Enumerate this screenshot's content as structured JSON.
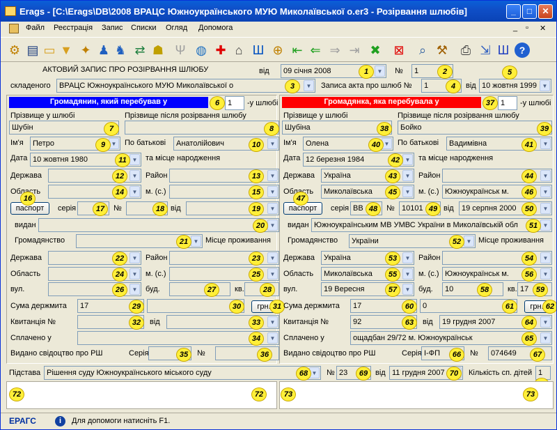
{
  "window": {
    "title": "Erags - [C:\\Erags\\DB\\2008 ВРАЦС Южноукраїнського МУЮ Миколаївської о.er3 - Розірвання шлюбів]",
    "min": "_",
    "max": "□",
    "close": "✕"
  },
  "menu": {
    "items": [
      "Файл",
      "Реєстрація",
      "Запис",
      "Списки",
      "Огляд",
      "Допомога"
    ],
    "min": "_",
    "restore": "▫",
    "close": "✕"
  },
  "header": {
    "title": "АКТОВИЙ ЗАПИС ПРО РОЗІРВАННЯ ШЛЮБУ",
    "vid": "від",
    "date": "09 січня 2008",
    "num_label": "№",
    "num": "1",
    "skl_label": "складеного",
    "skl": "ВРАЦС Южноукраїнського МУЮ Миколаївської о",
    "zap_label": "Записа акта про шлюб №",
    "zap": "1",
    "zap_vid": "від",
    "zap_date": "10 жовтня 1999"
  },
  "man": {
    "header": "Громадянин, який перебував у",
    "times": "1",
    "times_label": "-у шлюбі",
    "surname_label": "Прізвище у шлюбі",
    "surname": "Шубін",
    "surname_after_label": "Прізвище після розірвання шлюбу",
    "surname_after": "",
    "name_label": "Ім'я",
    "name": "Петро",
    "patr_label": "По батькові",
    "patr": "Анатолійович",
    "date_label": "Дата",
    "dob": "10 жовтня 1980",
    "birth_label": "та місце народження",
    "state_label": "Держава",
    "state": "",
    "district_label": "Район",
    "district": "",
    "region_label": "Область",
    "region": "",
    "city_label": "м. (с.)",
    "city": "",
    "passport": "паспорт",
    "series_label": "серія",
    "series": "",
    "no_label": "№",
    "pno": "",
    "pvid": "від",
    "pdate": "",
    "issued_label": "видан",
    "issued": "",
    "cit_label": "Громадянство",
    "cit": "",
    "res_label": "Місце проживання",
    "rstate": "",
    "rdistrict": "",
    "rregion": "",
    "rcity": "",
    "street_label": "вул.",
    "street": "",
    "bld_label": "буд.",
    "bld": "",
    "apt_label": "кв.",
    "apt": "",
    "fee_label": "Сума держмита",
    "fee": "17",
    "fee2": "",
    "grn": "грн.",
    "rec_label": "Квитанція №",
    "rec": "",
    "rec_vid": "від",
    "rec_date": "",
    "paid_label": "Сплачено у",
    "paid": "",
    "cert_label": "Видано свідоцтво про РШ",
    "cert_series_label": "Серія",
    "cert_series": "",
    "cert_no_label": "№",
    "cert_no": ""
  },
  "woman": {
    "header": "Громадянка, яка перебувала у",
    "times": "1",
    "times_label": "-у шлюбі",
    "surname_label": "Прізвище у шлюбі",
    "surname": "Шубіна",
    "surname_after_label": "Прізвище після розірвання шлюбу",
    "surname_after": "Бойко",
    "name_label": "Ім'я",
    "name": "Олена",
    "patr_label": "По батькові",
    "patr": "Вадимівна",
    "date_label": "Дата",
    "dob": "12 березня 1984",
    "birth_label": "та місце народження",
    "state_label": "Держава",
    "state": "Україна",
    "district_label": "Район",
    "district": "",
    "region_label": "Область",
    "region": "Миколаївська",
    "city_label": "м. (с.)",
    "city": "Южноукраїнськ м.",
    "passport": "паспорт",
    "series_label": "серія",
    "series": "ВВ",
    "no_label": "№",
    "pno": "10101",
    "pvid": "від",
    "pdate": "19 серпня 2000",
    "issued_label": "видан",
    "issued": "Южноукраїнським МВ УМВС України в Миколаївській обл",
    "cit_label": "Громадянство",
    "cit": "України",
    "res_label": "Місце проживання",
    "rstate": "Україна",
    "rdistrict": "",
    "rregion": "Миколаївська",
    "rcity": "Южноукраїнськ м.",
    "street_label": "вул.",
    "street": "19 Вересня",
    "bld_label": "буд.",
    "bld": "10",
    "apt_label": "кв.",
    "apt": "17",
    "fee_label": "Сума держмита",
    "fee": "17",
    "fee2": "0",
    "grn": "грн.",
    "rec_label": "Квитанція №",
    "rec": "92",
    "rec_vid": "від",
    "rec_date": "19 грудня 2007",
    "paid_label": "Сплачено у",
    "paid": "ощадбан 29/72 м. Южноукраїнськ",
    "cert_label": "Видано свідоцтво про РШ",
    "cert_series_label": "Серія",
    "cert_series": "І-ФП",
    "cert_no_label": "№",
    "cert_no": "074649"
  },
  "basis": {
    "label": "Підстава",
    "value": "Рішення суду Южноукраїнського міського суду",
    "no_label": "№",
    "no": "23",
    "vid": "від",
    "date": "11 грудня 2007",
    "kids_label": "Кількість сп. дітей",
    "kids": "1"
  },
  "status": {
    "app": "ЕРАГС",
    "help": "Для допомоги натисніть F1."
  },
  "markers": [
    "1",
    "2",
    "3",
    "4",
    "5",
    "6",
    "7",
    "8",
    "9",
    "10",
    "11",
    "12",
    "13",
    "14",
    "15",
    "16",
    "17",
    "18",
    "19",
    "20",
    "21",
    "22",
    "23",
    "24",
    "25",
    "26",
    "27",
    "28",
    "29",
    "30",
    "31",
    "32",
    "33",
    "34",
    "35",
    "36",
    "37",
    "38",
    "39",
    "40",
    "41",
    "42",
    "43",
    "44",
    "45",
    "46",
    "47",
    "48",
    "49",
    "50",
    "51",
    "52",
    "53",
    "54",
    "55",
    "56",
    "57",
    "58",
    "59",
    "60",
    "61",
    "62",
    "63",
    "64",
    "65",
    "66",
    "67",
    "68",
    "69",
    "70",
    "71",
    "72",
    "72",
    "73",
    "73"
  ],
  "colors": {
    "man_header": "#0000ff",
    "woman_header": "#ff0000",
    "marker": "#ffef39",
    "title_bar": "#0a5fd8"
  }
}
